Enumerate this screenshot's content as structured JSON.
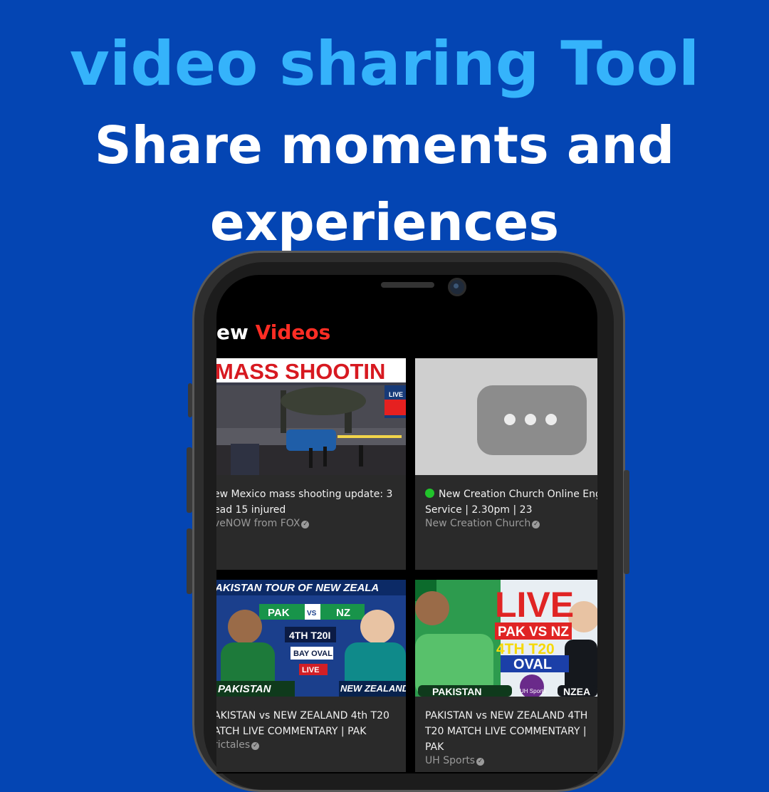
{
  "headline": {
    "title": "video sharing Tool",
    "subtitle_line1": "Share moments and",
    "subtitle_line2": "experiences"
  },
  "screen": {
    "section_title_prefix": "ew",
    "section_title_highlight": "Videos",
    "videos": [
      {
        "thumb_text": "MASS SHOOTIN",
        "thumb_badge": "LIVE",
        "title_line1": "ew Mexico mass shooting update: 3",
        "title_line2": "ead 15 injured",
        "channel": "veNOW from FOX",
        "verified": "✓"
      },
      {
        "thumb_text": "",
        "title_line1": "New Creation Church Online Engl",
        "title_line2": "Service | 2.30pm | 23",
        "channel": "New Creation Church",
        "verified": "✓"
      },
      {
        "thumb_banner": "AKISTAN TOUR OF NEW ZEALA",
        "thumb_pak": "PAK",
        "thumb_vs": "VS",
        "thumb_nz": "NZ",
        "thumb_match": "4TH T20I",
        "thumb_venue": "BAY OVAL",
        "thumb_live": "LIVE",
        "thumb_team1": "PAKISTAN",
        "thumb_team2": "NEW ZEALAND",
        "title_line1": "AKISTAN vs NEW ZEALAND 4th T20",
        "title_line2": "ATCH LIVE COMMENTARY | PAK",
        "channel": "rictales",
        "verified": "✓"
      },
      {
        "thumb_live": "LIVE",
        "thumb_matchup": "PAK VS NZ",
        "thumb_match": "4TH T20",
        "thumb_venue": "OVAL",
        "thumb_team1": "PAKISTAN",
        "thumb_team2": "NZEA",
        "thumb_logo": "UH Sports",
        "title_line1": "PAKISTAN vs NEW ZEALAND 4TH",
        "title_line2": "T20 MATCH LIVE COMMENTARY |",
        "title_line3": "PAK",
        "channel": "UH Sports",
        "verified": "✓"
      }
    ]
  },
  "colors": {
    "background": "#0445b3",
    "title": "#35b3fb",
    "highlight": "#ff2d24"
  }
}
